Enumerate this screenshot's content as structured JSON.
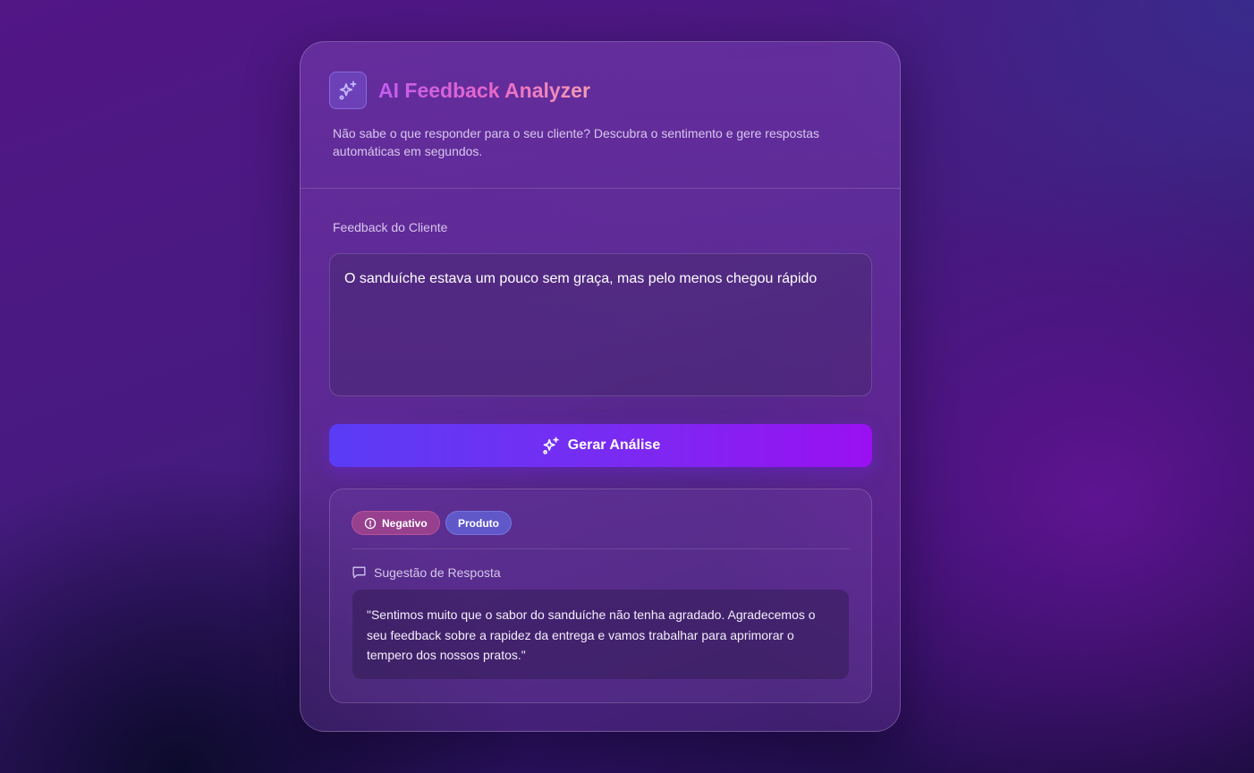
{
  "app": {
    "title": "AI Feedback Analyzer",
    "subtitle": "Não sabe o que responder para o seu cliente? Descubra o sentimento e gere respostas automáticas em segundos."
  },
  "form": {
    "feedback_label": "Feedback do Cliente",
    "feedback_value": "O sanduíche estava um pouco sem graça, mas pelo menos chegou rápido",
    "submit_label": "Gerar Análise"
  },
  "result": {
    "sentiment_badge": "Negativo",
    "category_badge": "Produto",
    "suggestion_title": "Sugestão de Resposta",
    "suggestion_text": "\"Sentimos muito que o sabor do sanduíche não tenha agradado. Agradecemos o seu feedback sobre a rapidez da entrega e vamos trabalhar para aprimorar o tempero dos nossos pratos.\""
  },
  "icons": {
    "logo": "sparkles-icon",
    "button": "sparkles-icon",
    "sentiment": "alert-circle-icon",
    "suggestion": "message-square-icon"
  },
  "colors": {
    "accent_start": "#5a3cf5",
    "accent_end": "#9a10f2",
    "negative_badge": "#c8508c",
    "category_badge": "#646ee6"
  }
}
